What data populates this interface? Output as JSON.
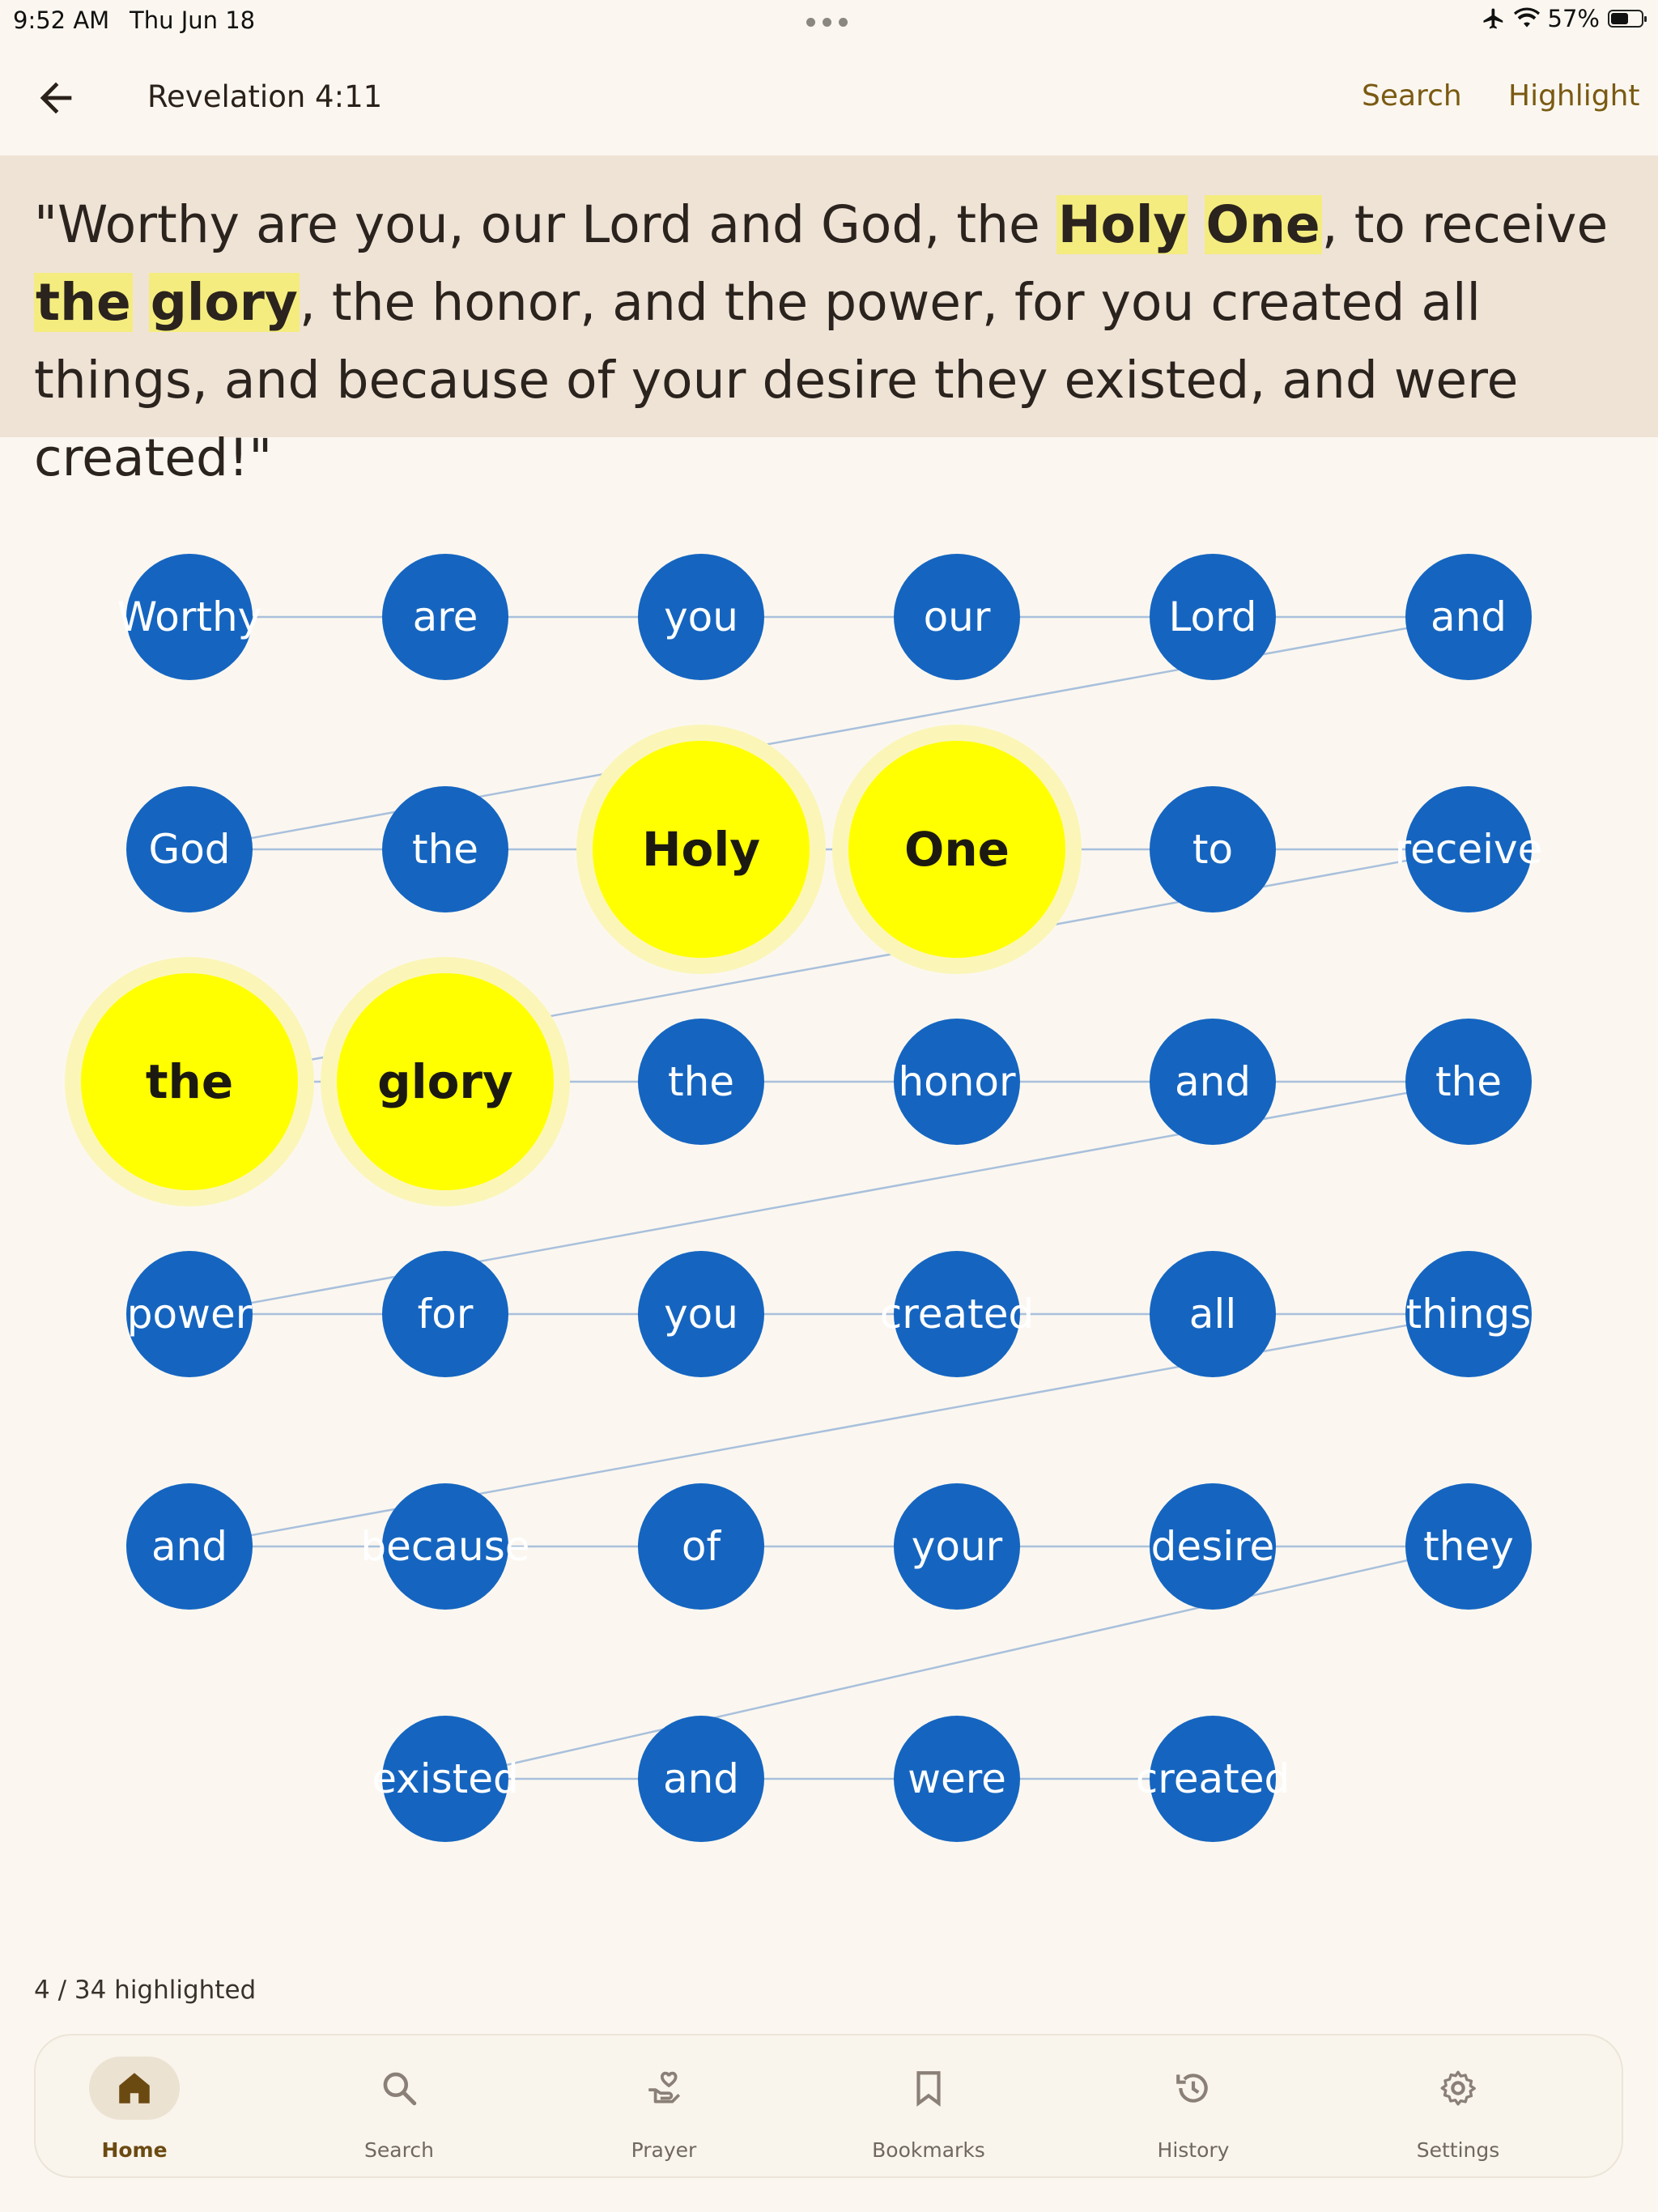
{
  "status": {
    "time": "9:52 AM",
    "date": "Thu Jun 18",
    "battery": "57%",
    "battery_level": 0.57
  },
  "header": {
    "title": "Revelation 4:11",
    "search_label": "Search",
    "highlight_label": "Highlight"
  },
  "verse": {
    "segments": [
      {
        "text": "\"Worthy are you, our Lord and God, the ",
        "hl": false
      },
      {
        "text": "Holy",
        "hl": true
      },
      {
        "text": " ",
        "hl": false
      },
      {
        "text": "One",
        "hl": true
      },
      {
        "text": ", to receive ",
        "hl": false
      },
      {
        "text": "the",
        "hl": true
      },
      {
        "text": " ",
        "hl": false
      },
      {
        "text": "glory",
        "hl": true
      },
      {
        "text": ", the honor, and the power, for you created all things, and because of your desire they existed, and were created!\"",
        "hl": false
      }
    ]
  },
  "words": [
    "Worthy",
    "are",
    "you",
    "our",
    "Lord",
    "and",
    "God",
    "the",
    "Holy",
    "One",
    "to",
    "receive",
    "the",
    "glory",
    "the",
    "honor",
    "and",
    "the",
    "power",
    "for",
    "you",
    "created",
    "all",
    "things",
    "and",
    "because",
    "of",
    "your",
    "desire",
    "they",
    "existed",
    "and",
    "were",
    "created"
  ],
  "highlighted_indices": [
    8,
    9,
    12,
    13
  ],
  "highlight_count": "4 / 34 highlighted",
  "colors": {
    "node": "#1565c0",
    "node_highlight": "#ffff00",
    "edge": "#a9c0dc",
    "accent": "#7a5a12"
  },
  "nav": {
    "items": [
      {
        "label": "Home",
        "icon": "home-icon",
        "active": true
      },
      {
        "label": "Search",
        "icon": "search-icon",
        "active": false
      },
      {
        "label": "Prayer",
        "icon": "prayer-icon",
        "active": false
      },
      {
        "label": "Bookmarks",
        "icon": "bookmark-icon",
        "active": false
      },
      {
        "label": "History",
        "icon": "history-icon",
        "active": false
      },
      {
        "label": "Settings",
        "icon": "settings-icon",
        "active": false
      }
    ]
  }
}
